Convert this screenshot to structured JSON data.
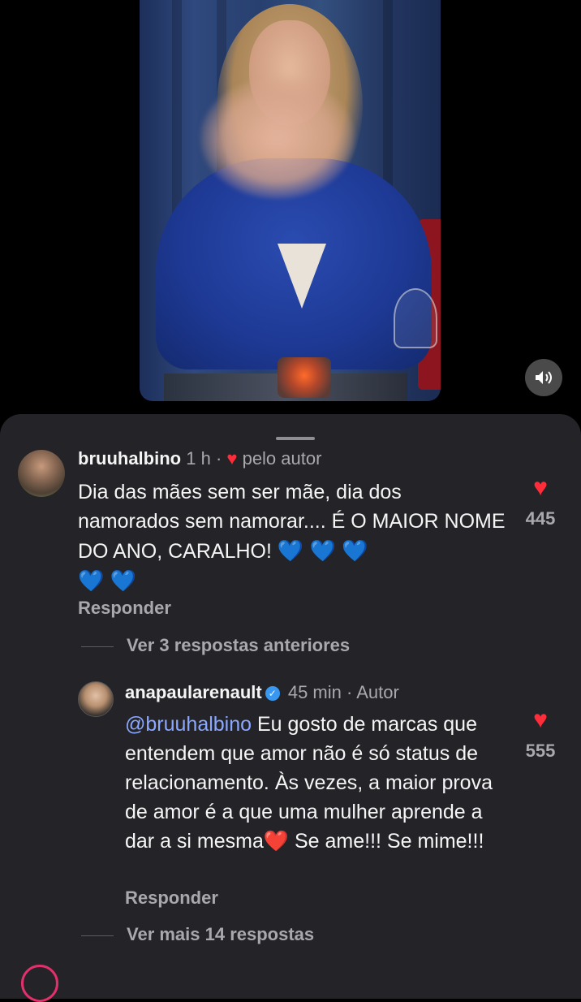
{
  "video": {
    "mute_icon": "speaker-on-icon"
  },
  "comments": [
    {
      "username": "bruuhalbino",
      "time": "1 h",
      "separator": "·",
      "liked_by_author": "pelo autor",
      "text": "Dia das mães sem ser mãe, dia dos namorados sem namorar.... É O MAIOR NOME DO ANO, CARALHO!",
      "emojis_line1": "💙 💙 💙",
      "emojis_line2": "💙 💙",
      "likes": "445",
      "reply_label": "Responder",
      "view_replies": "Ver 3 respostas anteriores"
    },
    {
      "username": "anapaularenault",
      "verified": true,
      "time": "45 min",
      "separator": "·",
      "badge": "Autor",
      "mention": "@bruuhalbino",
      "text_before_emoji": " Eu gosto de marcas que entendem que amor não é só status de relacionamento. Às vezes, a maior prova de amor é a que uma mulher aprende a dar a si mesma",
      "emoji": "❤️",
      "text_after_emoji": " Se ame!!! Se mime!!!",
      "likes": "555",
      "reply_label": "Responder",
      "view_replies": "Ver mais 14 respostas"
    }
  ],
  "colors": {
    "sheet_bg": "#242428",
    "heart": "#ff2d3a",
    "mention": "#8aa8ff",
    "verified": "#3897f0"
  }
}
